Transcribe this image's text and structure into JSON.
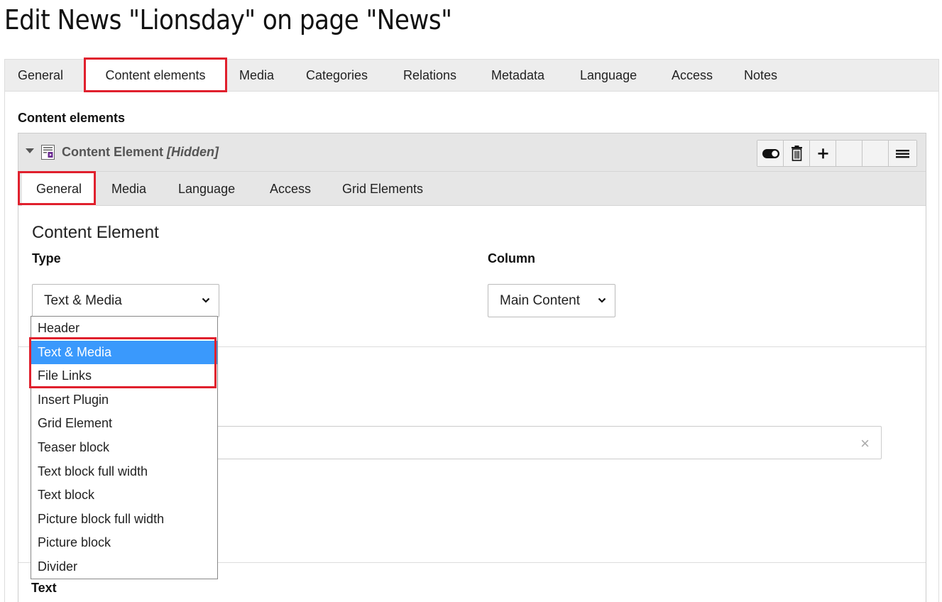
{
  "page_title": "Edit News \"Lionsday\" on page \"News\"",
  "outer_tabs": [
    {
      "label": "General"
    },
    {
      "label": "Content elements"
    },
    {
      "label": "Media"
    },
    {
      "label": "Categories"
    },
    {
      "label": "Relations"
    },
    {
      "label": "Metadata"
    },
    {
      "label": "Language"
    },
    {
      "label": "Access"
    },
    {
      "label": "Notes"
    }
  ],
  "outer_active_tab": "Content elements",
  "section_label": "Content elements",
  "record": {
    "title": "Content Element",
    "hidden_tag": "[Hidden]",
    "icons": [
      "content-element-icon",
      "toggle-visibility-icon",
      "trash-icon",
      "plus-icon",
      "drag-handle-icon"
    ],
    "tabs": [
      {
        "label": "General"
      },
      {
        "label": "Media"
      },
      {
        "label": "Language"
      },
      {
        "label": "Access"
      },
      {
        "label": "Grid Elements"
      }
    ],
    "active_tab": "General",
    "heading": "Content Element",
    "type_label": "Type",
    "type_value": "Text & Media",
    "column_label": "Column",
    "column_value": "Main Content",
    "text_label": "Text"
  },
  "dropdown_options": [
    "Header",
    "Text & Media",
    "File Links",
    "Insert Plugin",
    "Grid Element",
    "Teaser block",
    "Text block full width",
    "Text block",
    "Picture block full width",
    "Picture block",
    "Divider"
  ],
  "dropdown_selected": "Text & Media",
  "colors": {
    "highlight": "#e0202d",
    "selected_option": "#3a99fc",
    "tab_bar": "#ededed",
    "record_header": "#e6e6e6"
  }
}
